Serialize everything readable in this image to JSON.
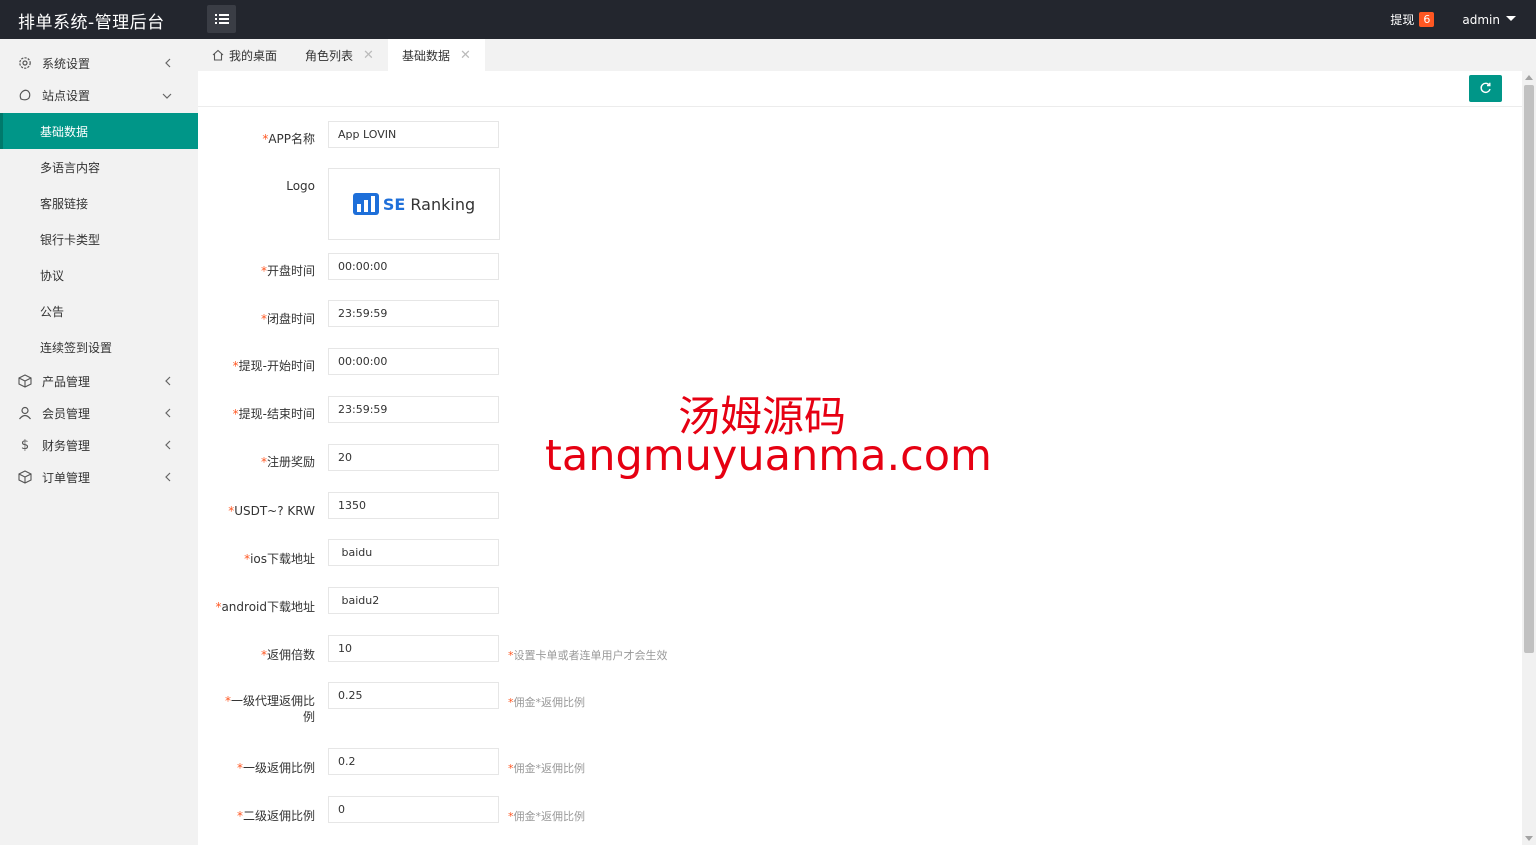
{
  "header": {
    "title": "排单系统-管理后台",
    "withdraw_label": "提现",
    "withdraw_count": "6",
    "user": "admin"
  },
  "sidebar": {
    "groups": [
      {
        "label": "系统设置",
        "icon": "gear-icon"
      },
      {
        "label": "站点设置",
        "icon": "site-icon"
      }
    ],
    "sub_items": [
      "基础数据",
      "多语言内容",
      "客服链接",
      "银行卡类型",
      "协议",
      "公告",
      "连续签到设置"
    ],
    "more_groups": [
      {
        "label": "产品管理",
        "icon": "cube-icon"
      },
      {
        "label": "会员管理",
        "icon": "user-icon"
      },
      {
        "label": "财务管理",
        "icon": "dollar-icon"
      },
      {
        "label": "订单管理",
        "icon": "cube-icon"
      }
    ]
  },
  "tabs": [
    "我的桌面",
    "角色列表",
    "基础数据"
  ],
  "form": {
    "app_name": {
      "label": "APP名称",
      "value": "App LOVIN"
    },
    "logo": {
      "label": "Logo",
      "brand_prefix": "SE",
      "brand_suffix": "Ranking"
    },
    "open_time": {
      "label": "开盘时间",
      "value": "00:00:00"
    },
    "close_time": {
      "label": "闭盘时间",
      "value": "23:59:59"
    },
    "withdraw_start": {
      "label": "提现-开始时间",
      "value": "00:00:00"
    },
    "withdraw_end": {
      "label": "提现-结束时间",
      "value": "23:59:59"
    },
    "register_reward": {
      "label": "注册奖励",
      "value": "20"
    },
    "usdt_krw": {
      "label": "USDT~? KRW",
      "value": "1350"
    },
    "ios_url": {
      "label": "ios下载地址",
      "value": " baidu"
    },
    "android_url": {
      "label": "android下载地址",
      "value": " baidu2"
    },
    "rebate_multiple": {
      "label": "返佣倍数",
      "value": "10",
      "hint": "设置卡单或者连单用户才会生效"
    },
    "l1_agent_rate": {
      "label_line1": "一级代理返佣比",
      "label_line2": "例",
      "value": "0.25",
      "hint": "佣金*返佣比例"
    },
    "l1_rate": {
      "label": "一级返佣比例",
      "value": "0.2",
      "hint": "佣金*返佣比例"
    },
    "l2_rate": {
      "label": "二级返佣比例",
      "value": "0",
      "hint": "佣金*返佣比例"
    }
  },
  "watermark": {
    "line1": "汤姆源码",
    "line2": "tangmuyuanma.com"
  },
  "colors": {
    "header_bg": "#23262e",
    "accent": "#009688",
    "required": "#ff5722",
    "watermark": "#e60012"
  }
}
